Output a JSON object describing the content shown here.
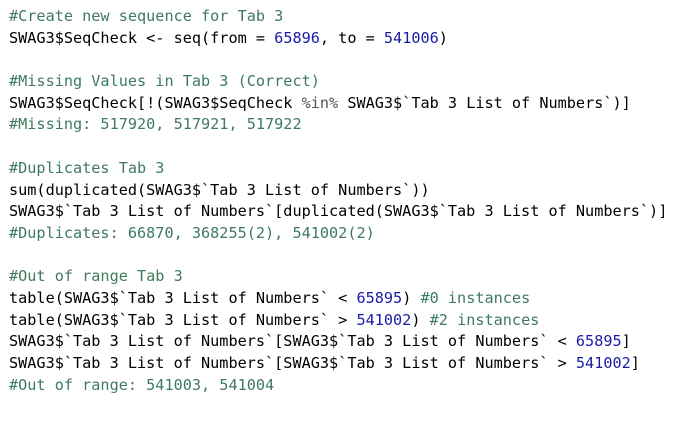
{
  "editor": {
    "lines": [
      [
        {
          "t": "#Create new sequence for Tab 3",
          "c": "comment"
        }
      ],
      [
        {
          "t": "SWAG3$SeqCheck <- seq(from = ",
          "c": "code"
        },
        {
          "t": "65896",
          "c": "num"
        },
        {
          "t": ", to = ",
          "c": "code"
        },
        {
          "t": "541006",
          "c": "num"
        },
        {
          "t": ")",
          "c": "code"
        }
      ],
      [],
      [
        {
          "t": "#Missing Values in Tab 3 (Correct)",
          "c": "comment"
        }
      ],
      [
        {
          "t": "SWAG3$SeqCheck[!(SWAG3$SeqCheck ",
          "c": "code"
        },
        {
          "t": "%in%",
          "c": "dim"
        },
        {
          "t": " SWAG3$`Tab 3 List of Numbers`)]",
          "c": "code"
        }
      ],
      [
        {
          "t": "#Missing: 517920, 517921, 517922",
          "c": "comment"
        }
      ],
      [],
      [
        {
          "t": "#Duplicates Tab 3",
          "c": "comment"
        }
      ],
      [
        {
          "t": "sum(duplicated(SWAG3$`Tab 3 List of Numbers`))",
          "c": "code"
        }
      ],
      [
        {
          "t": "SWAG3$`Tab 3 List of Numbers`[duplicated(SWAG3$`Tab 3 List of Numbers`)]",
          "c": "code"
        }
      ],
      [
        {
          "t": "#Duplicates: 66870, 368255(2), 541002(2)",
          "c": "comment"
        }
      ],
      [],
      [
        {
          "t": "#Out of range Tab 3",
          "c": "comment"
        }
      ],
      [
        {
          "t": "table(SWAG3$`Tab 3 List of Numbers` < ",
          "c": "code"
        },
        {
          "t": "65895",
          "c": "num"
        },
        {
          "t": ") ",
          "c": "code"
        },
        {
          "t": "#0 instances",
          "c": "comment"
        }
      ],
      [
        {
          "t": "table(SWAG3$`Tab 3 List of Numbers` > ",
          "c": "code"
        },
        {
          "t": "541002",
          "c": "num"
        },
        {
          "t": ") ",
          "c": "code"
        },
        {
          "t": "#2 instances",
          "c": "comment"
        }
      ],
      [
        {
          "t": "SWAG3$`Tab 3 List of Numbers`[SWAG3$`Tab 3 List of Numbers` < ",
          "c": "code"
        },
        {
          "t": "65895",
          "c": "num"
        },
        {
          "t": "]",
          "c": "code"
        }
      ],
      [
        {
          "t": "SWAG3$`Tab 3 List of Numbers`[SWAG3$`Tab 3 List of Numbers` > ",
          "c": "code"
        },
        {
          "t": "541002",
          "c": "num"
        },
        {
          "t": "]",
          "c": "code"
        }
      ],
      [
        {
          "t": "#Out of range: 541003, 541004",
          "c": "comment"
        }
      ]
    ],
    "colors": {
      "comment": "#3e7a5e",
      "number": "#1a1aa6",
      "code": "#000000",
      "operator": "#555555",
      "background": "#ffffff"
    }
  }
}
